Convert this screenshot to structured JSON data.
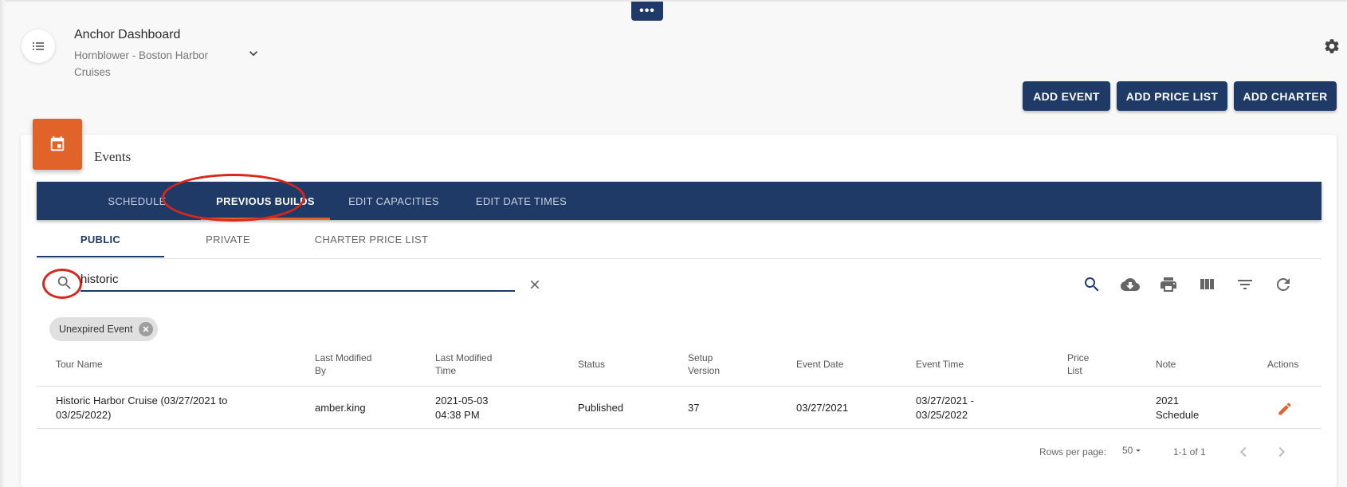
{
  "header": {
    "more_label": "•••",
    "title": "Anchor Dashboard",
    "subtitle": "Hornblower - Boston Harbor Cruises",
    "icons": {
      "menu": "list-icon",
      "dropdown": "chevron-down-icon",
      "settings": "gear-icon"
    }
  },
  "actions": {
    "add_event": "ADD EVENT",
    "add_price_list": "ADD PRICE LIST",
    "add_charter": "ADD CHARTER"
  },
  "card": {
    "title": "Events",
    "icon": "calendar-icon",
    "accent_color": "#e2632a"
  },
  "tabs": [
    {
      "label": "SCHEDULE",
      "active": false
    },
    {
      "label": "PREVIOUS BUILDS",
      "active": true
    },
    {
      "label": "EDIT CAPACITIES",
      "active": false
    },
    {
      "label": "EDIT DATE TIMES",
      "active": false
    }
  ],
  "subtabs": [
    {
      "label": "PUBLIC",
      "active": true
    },
    {
      "label": "PRIVATE",
      "active": false
    },
    {
      "label": "CHARTER PRICE LIST",
      "active": false
    }
  ],
  "search": {
    "value": "historic",
    "placeholder": ""
  },
  "toolbar_icons": [
    "search-icon",
    "cloud-download-icon",
    "print-icon",
    "view-column-icon",
    "filter-icon",
    "refresh-icon"
  ],
  "filter_chip": "Unexpired Event",
  "table": {
    "columns": [
      "Tour Name",
      "Last Modified By",
      "Last Modified Time",
      "Status",
      "Setup Version",
      "Event Date",
      "Event Time",
      "Price List",
      "Note",
      "Actions"
    ],
    "rows": [
      {
        "tour_name": "Historic Harbor Cruise (03/27/2021 to 03/25/2022)",
        "last_modified_by": "amber.king",
        "last_modified_time": "2021-05-03 04:38 PM",
        "status": "Published",
        "setup_version": "37",
        "event_date": "03/27/2021",
        "event_time": "03/27/2021 - 03/25/2022",
        "price_list": "",
        "note": "2021 Schedule",
        "action_icon": "edit-icon"
      }
    ]
  },
  "pagination": {
    "rows_per_page_label": "Rows per page:",
    "rows_per_page": "50",
    "range": "1-1 of 1"
  },
  "colors": {
    "primary": "#1f3a66",
    "accent": "#e2632a",
    "annotation": "#d8281b"
  }
}
